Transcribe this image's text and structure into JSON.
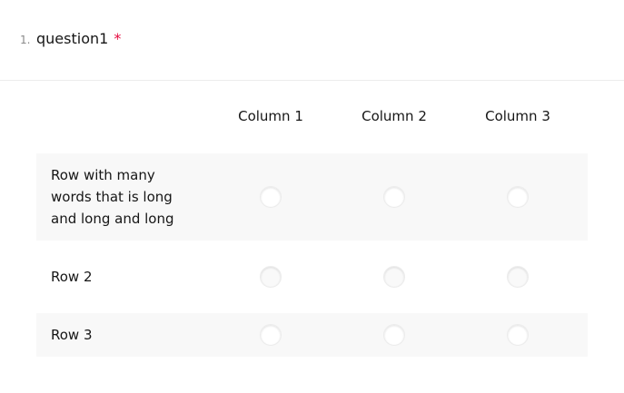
{
  "question": {
    "number": "1.",
    "title": "question1",
    "required_mark": "*"
  },
  "matrix": {
    "columns": [
      "Column 1",
      "Column 2",
      "Column 3"
    ],
    "rows": [
      {
        "label": "Row with many words that is long and long and long"
      },
      {
        "label": "Row 2"
      },
      {
        "label": "Row 3"
      }
    ]
  },
  "colors": {
    "required": "#e50a3e",
    "row_alt_background": "#f8f8f8",
    "text": "#161616"
  }
}
